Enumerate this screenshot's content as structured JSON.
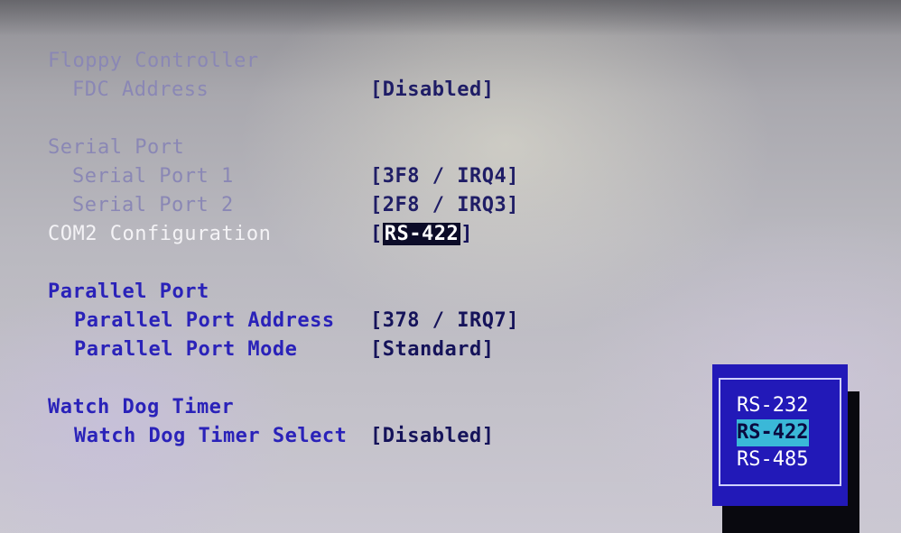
{
  "floppy": {
    "section_label": "Floppy Controller",
    "fdc_address_label": "FDC Address",
    "fdc_address_value": "[Disabled]"
  },
  "serial": {
    "section_label": "Serial Port",
    "port1_label": "Serial Port 1",
    "port1_value": "[3F8 / IRQ4]",
    "port2_label": "Serial Port 2",
    "port2_value": "[2F8 / IRQ3]",
    "com2_label": "COM2 Configuration",
    "com2_open_bracket": "[",
    "com2_value": "RS-422",
    "com2_close_bracket": "]"
  },
  "parallel": {
    "section_label": "Parallel Port",
    "address_label": "Parallel Port Address",
    "address_value": "[378 / IRQ7]",
    "mode_label": "Parallel Port Mode",
    "mode_value": "[Standard]"
  },
  "watchdog": {
    "section_label": "Watch Dog Timer",
    "select_label": "Watch Dog Timer Select",
    "select_value": "[Disabled]"
  },
  "popup": {
    "options": [
      "RS-232",
      "RS-422",
      "RS-485"
    ],
    "selected": "RS-422"
  },
  "colors": {
    "popup_background": "#2219b8",
    "highlight": "#3ab8d8",
    "section_blue": "#2a22b9"
  }
}
